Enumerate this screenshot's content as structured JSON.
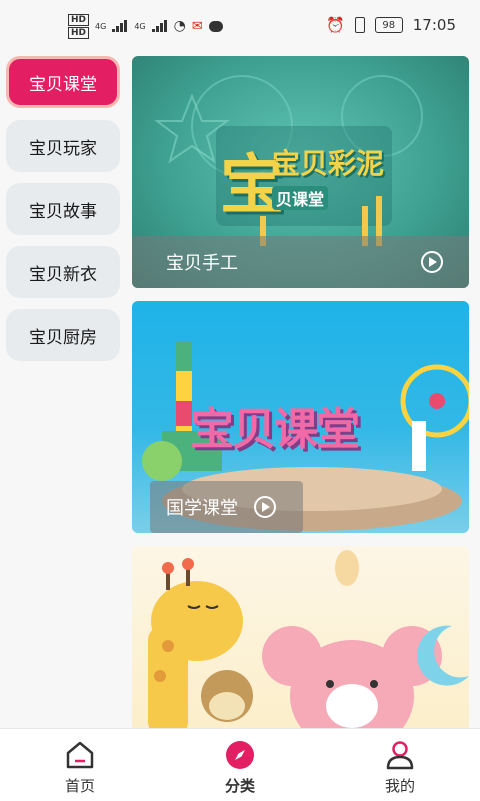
{
  "status_bar": {
    "time": "17:05",
    "battery": "98",
    "net1": "4G",
    "net2": "4G",
    "hd": "HD"
  },
  "sidebar": {
    "items": [
      {
        "label": "宝贝课堂"
      },
      {
        "label": "宝贝玩家"
      },
      {
        "label": "宝贝故事"
      },
      {
        "label": "宝贝新衣"
      },
      {
        "label": "宝贝厨房"
      }
    ]
  },
  "cards": [
    {
      "title": "宝贝手工",
      "art_text": "宝",
      "art_text2": "宝贝彩泥",
      "art_text3": "贝课堂"
    },
    {
      "title": "国学课堂",
      "art_text": "宝贝课堂"
    },
    {
      "title": ""
    }
  ],
  "bottom_nav": {
    "tabs": [
      {
        "label": "首页"
      },
      {
        "label": "分类"
      },
      {
        "label": "我的"
      }
    ]
  },
  "colors": {
    "accent": "#e41e63"
  }
}
